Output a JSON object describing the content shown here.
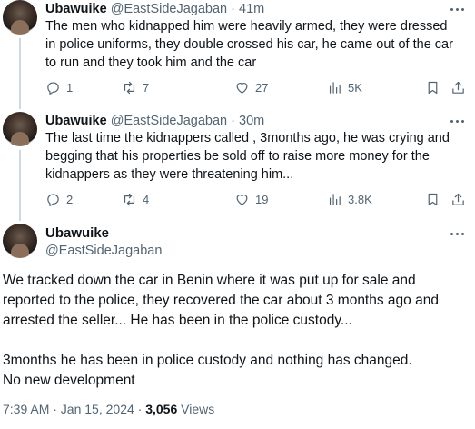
{
  "tweets": [
    {
      "name": "Ubawuike",
      "handle": "@EastSideJagaban",
      "dot": "·",
      "time": "41m",
      "text": "The men who kidnapped him were heavily armed, they were dressed in police uniforms, they double crossed his car, he came out of the car to run and they took him and the car",
      "replies": "1",
      "reposts": "7",
      "likes": "27",
      "views": "5K"
    },
    {
      "name": "Ubawuike",
      "handle": "@EastSideJagaban",
      "dot": "·",
      "time": "30m",
      "text": "The last time the kidnappers called , 3months ago, he was crying and begging that his properties be sold off to raise more money for the kidnappers as they were threatening him...",
      "replies": "2",
      "reposts": "4",
      "likes": "19",
      "views": "3.8K"
    }
  ],
  "main_tweet": {
    "name": "Ubawuike",
    "handle": "@EastSideJagaban",
    "paragraph1": "We tracked down the car in Benin where it was put up for sale and reported to the police,  they recovered the car about 3 months ago and arrested the seller... He has been in the police custody...",
    "paragraph2": "3months he has been in police custody and nothing has changed.",
    "paragraph3": "No new development",
    "timestamp": "7:39 AM · Jan 15, 2024 · ",
    "views_count": "3,056",
    "views_label": " Views"
  },
  "icons": {
    "reply": "reply-icon",
    "repost": "repost-icon",
    "like": "heart-icon",
    "views": "views-chart-icon",
    "bookmark": "bookmark-icon",
    "share": "share-icon",
    "more": "more-icon"
  }
}
